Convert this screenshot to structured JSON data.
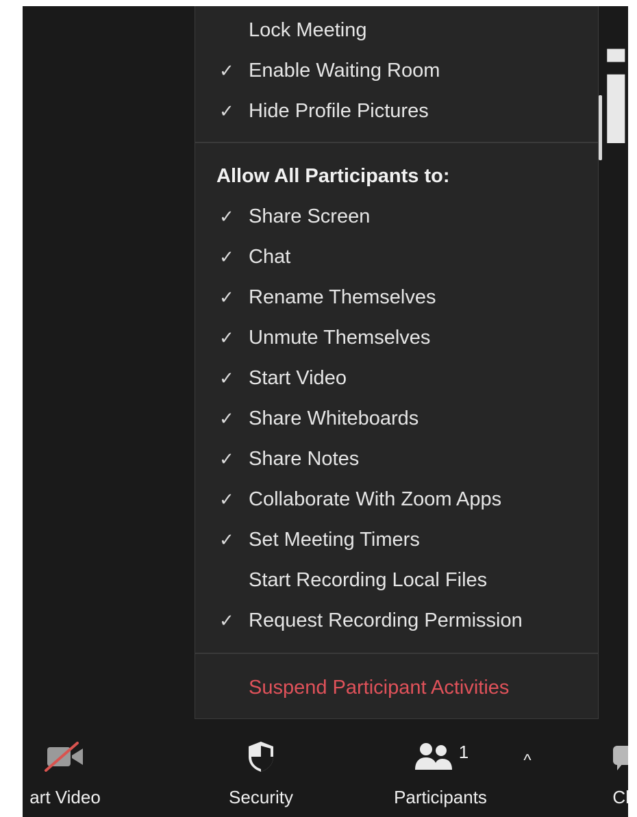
{
  "background": {
    "glyph": "it"
  },
  "menu": {
    "top_items": [
      {
        "label": "Lock Meeting",
        "checked": false
      },
      {
        "label": "Enable Waiting Room",
        "checked": true
      },
      {
        "label": "Hide Profile Pictures",
        "checked": true
      }
    ],
    "allow_header": "Allow All Participants to:",
    "allow_items": [
      {
        "label": "Share Screen",
        "checked": true
      },
      {
        "label": "Chat",
        "checked": true
      },
      {
        "label": "Rename Themselves",
        "checked": true
      },
      {
        "label": "Unmute Themselves",
        "checked": true
      },
      {
        "label": "Start Video",
        "checked": true
      },
      {
        "label": "Share Whiteboards",
        "checked": true
      },
      {
        "label": "Share Notes",
        "checked": true
      },
      {
        "label": "Collaborate With Zoom Apps",
        "checked": true
      },
      {
        "label": "Set Meeting Timers",
        "checked": true
      },
      {
        "label": "Start Recording Local Files",
        "checked": false
      },
      {
        "label": "Request Recording Permission",
        "checked": true
      }
    ],
    "suspend_label": "Suspend Participant Activities",
    "check_glyph": "✓",
    "danger_color": "#e0525a"
  },
  "toolbar": {
    "start_video_label": "art Video",
    "security_label": "Security",
    "participants_label": "Participants",
    "participants_count": "1",
    "caret": "^",
    "chat_label": "Ch"
  }
}
